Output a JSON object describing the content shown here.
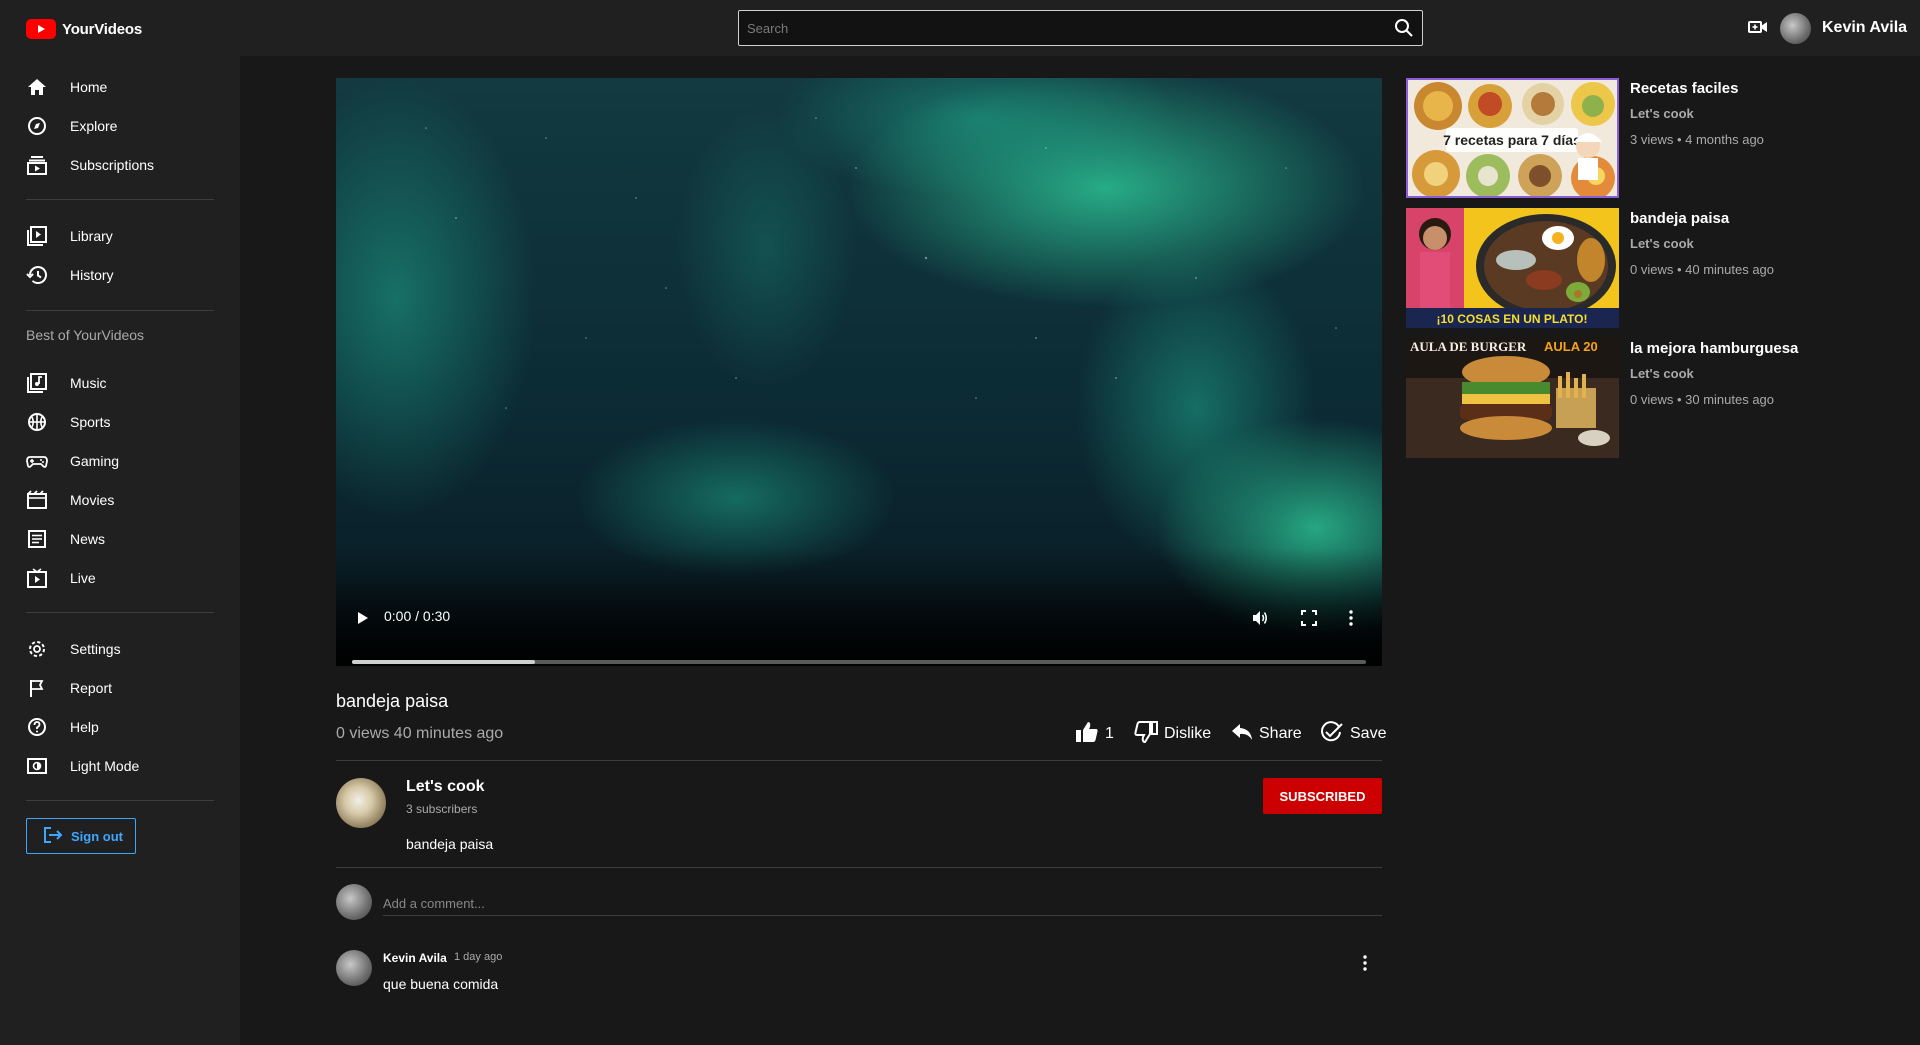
{
  "app": {
    "name": "YourVideos",
    "accent": "#ff0000",
    "link_color": "#3ea6ff"
  },
  "header": {
    "search_placeholder": "Search",
    "username": "Kevin Avila"
  },
  "sidebar": {
    "primary": [
      {
        "label": "Home",
        "icon": "home-icon"
      },
      {
        "label": "Explore",
        "icon": "compass-icon"
      },
      {
        "label": "Subscriptions",
        "icon": "subscriptions-icon"
      }
    ],
    "library": [
      {
        "label": "Library",
        "icon": "library-icon"
      },
      {
        "label": "History",
        "icon": "history-icon"
      }
    ],
    "best_of_title": "Best of YourVideos",
    "best_of": [
      {
        "label": "Music",
        "icon": "music-icon"
      },
      {
        "label": "Sports",
        "icon": "sports-icon"
      },
      {
        "label": "Gaming",
        "icon": "gaming-icon"
      },
      {
        "label": "Movies",
        "icon": "movies-icon"
      },
      {
        "label": "News",
        "icon": "news-icon"
      },
      {
        "label": "Live",
        "icon": "live-icon"
      }
    ],
    "settings": [
      {
        "label": "Settings",
        "icon": "gear-icon"
      },
      {
        "label": "Report",
        "icon": "flag-icon"
      },
      {
        "label": "Help",
        "icon": "help-icon"
      },
      {
        "label": "Light Mode",
        "icon": "light-mode-icon"
      }
    ],
    "sign_out": "Sign out"
  },
  "player": {
    "time": "0:00 / 0:30",
    "progress_fraction": 0.18
  },
  "video": {
    "title": "bandeja paisa",
    "meta": "0 views 40 minutes ago",
    "likes": "1",
    "dislike_label": "Dislike",
    "share_label": "Share",
    "save_label": "Save"
  },
  "channel": {
    "name": "Let's cook",
    "subscribers": "3 subscribers",
    "description": "bandeja paisa",
    "subscribe_label": "SUBSCRIBED"
  },
  "comments": {
    "placeholder": "Add a comment...",
    "items": [
      {
        "author": "Kevin Avila",
        "time": "1 day ago",
        "text": "que buena comida"
      }
    ]
  },
  "recommendations": [
    {
      "title": "Recetas faciles",
      "channel": "Let's cook",
      "meta": "3 views • 4 months ago",
      "thumb_text": "7 recetas para 7 días"
    },
    {
      "title": "bandeja paisa",
      "channel": "Let's cook",
      "meta": "0 views • 40 minutes ago",
      "thumb_text": "¡10 COSAS EN UN PLATO!"
    },
    {
      "title": "la mejora hamburguesa",
      "channel": "Let's cook",
      "meta": "0 views • 30 minutes ago",
      "thumb_text": "AULA DE BURGER",
      "thumb_text_2": "AULA 20"
    }
  ]
}
